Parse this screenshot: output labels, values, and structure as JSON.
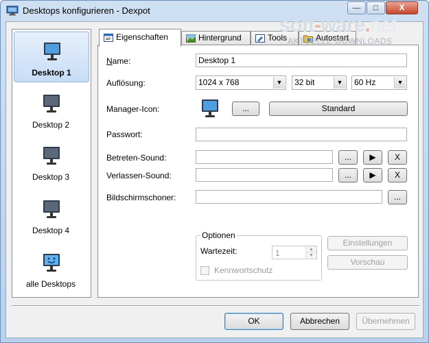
{
  "window": {
    "title": "Desktops konfigurieren - Dexpot",
    "minimize": "—",
    "maximize": "□",
    "close": "X"
  },
  "watermark": {
    "brand_a": "soft",
    "brand_dash": "-",
    "brand_b": "ware",
    "brand_dot": ".",
    "brand_c": "net",
    "sub": "AKTUELLE DOWNLOADS"
  },
  "sidebar": {
    "items": [
      {
        "label": "Desktop 1",
        "icon": "monitor-icon",
        "selected": true
      },
      {
        "label": "Desktop 2",
        "icon": "monitor-icon",
        "selected": false
      },
      {
        "label": "Desktop 3",
        "icon": "monitor-icon",
        "selected": false
      },
      {
        "label": "Desktop 4",
        "icon": "monitor-icon",
        "selected": false
      },
      {
        "label": "alle Desktops",
        "icon": "all-desktops-icon",
        "selected": false
      }
    ]
  },
  "tabs": [
    {
      "label": "Eigenschaften",
      "active": true
    },
    {
      "label": "Hintergrund",
      "active": false
    },
    {
      "label": "Tools",
      "active": false
    },
    {
      "label": "Autostart",
      "active": false
    }
  ],
  "form": {
    "name_label": "Name:",
    "name_value": "Desktop 1",
    "resolution_label": "Auflösung:",
    "resolution_value": "1024 x 768",
    "depth_value": "32 bit",
    "refresh_value": "60 Hz",
    "manager_icon_label": "Manager-Icon:",
    "browse_button": "...",
    "standard_button": "Standard",
    "password_label": "Passwort:",
    "password_value": "",
    "enter_sound_label": "Betreten-Sound:",
    "enter_sound_value": "",
    "leave_sound_label": "Verlassen-Sound:",
    "leave_sound_value": "",
    "screensaver_label": "Bildschirmschoner:",
    "screensaver_value": "",
    "play_glyph": "▶",
    "clear_glyph": "X"
  },
  "options": {
    "title": "Optionen",
    "wait_label": "Wartezeit:",
    "wait_value": "1",
    "password_protect_label": "Kennwortschutz",
    "settings_button": "Einstellungen",
    "preview_button": "Vorschau"
  },
  "footer": {
    "ok": "OK",
    "cancel": "Abbrechen",
    "apply": "Übernehmen"
  }
}
